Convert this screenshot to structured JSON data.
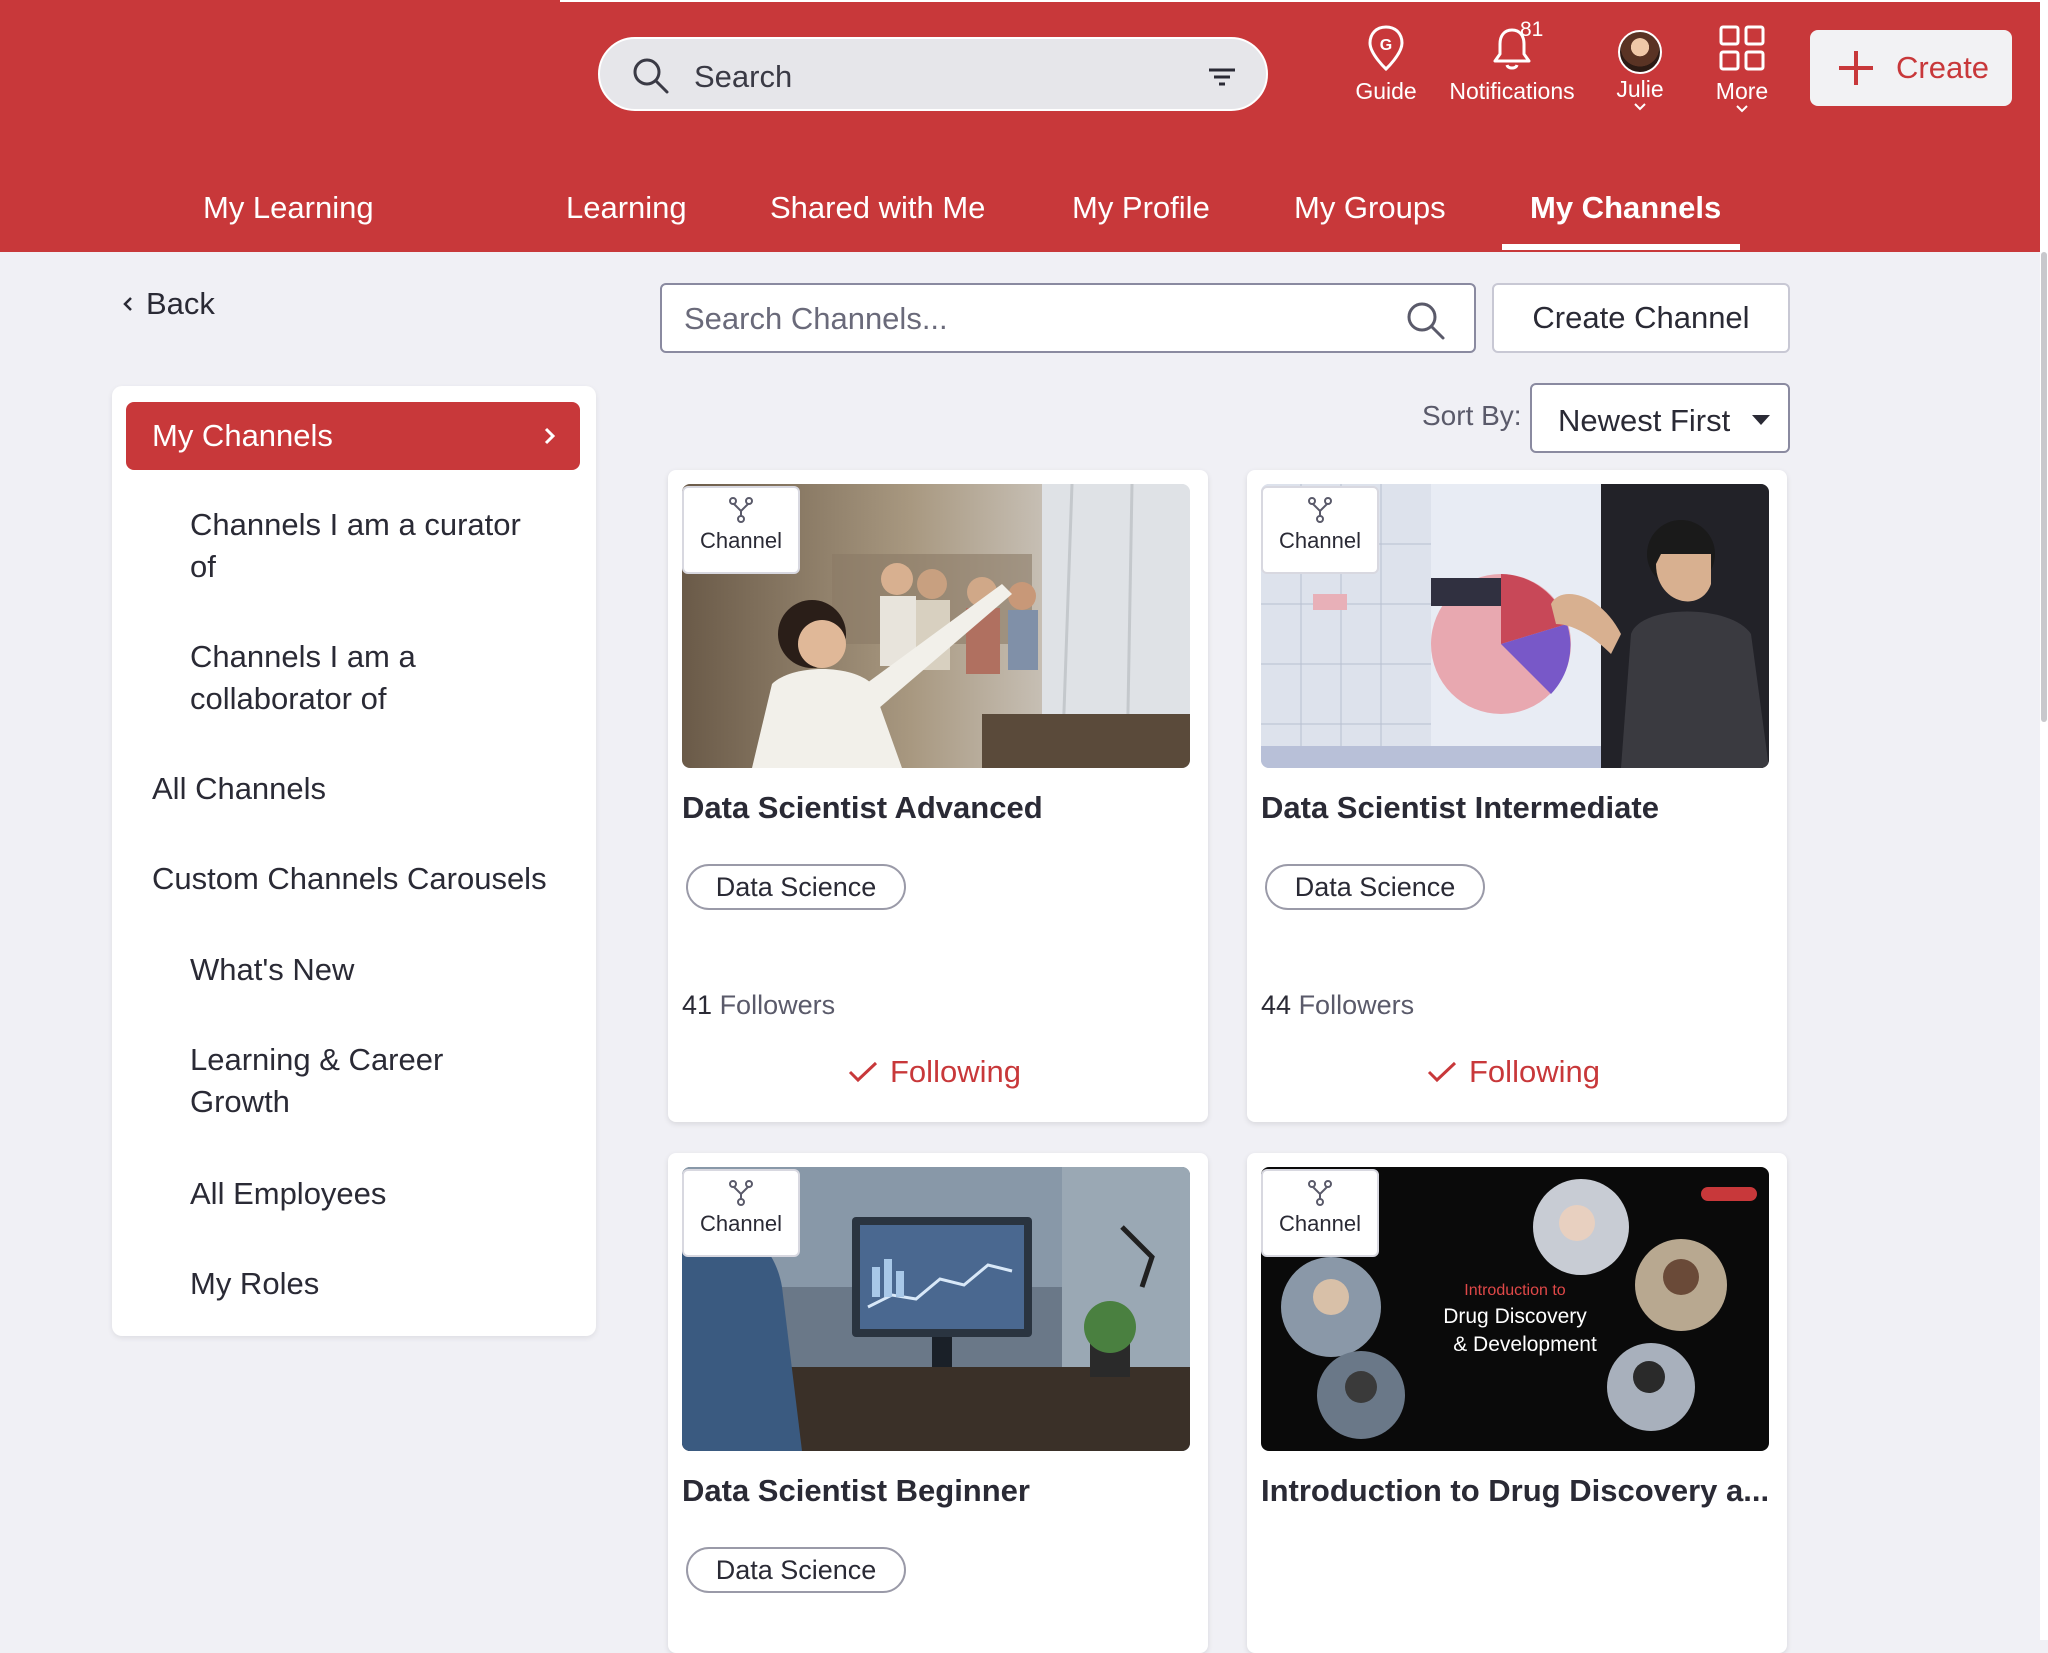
{
  "header": {
    "search_placeholder": "Search",
    "nav": {
      "guide": "Guide",
      "notifications": "Notifications",
      "notifications_count": "81",
      "user": "Julie",
      "more": "More"
    },
    "create_label": "Create"
  },
  "tabs": [
    {
      "label": "My Learning"
    },
    {
      "label": "Learning"
    },
    {
      "label": "Shared with Me"
    },
    {
      "label": "My Profile"
    },
    {
      "label": "My Groups"
    },
    {
      "label": "My Channels",
      "active": true
    }
  ],
  "sidebar": {
    "back_label": "Back",
    "active_item": "My Channels",
    "items": [
      {
        "label": "Channels I am a curator of"
      },
      {
        "label": "Channels I am a collaborator of"
      },
      {
        "label": "All Channels"
      },
      {
        "label": "Custom Channels Carousels"
      },
      {
        "label": "What's New"
      },
      {
        "label": "Learning & Career Growth"
      },
      {
        "label": "All Employees"
      },
      {
        "label": "My Roles"
      }
    ]
  },
  "content": {
    "search_placeholder": "Search Channels...",
    "create_channel_label": "Create Channel",
    "sort_label": "Sort By:",
    "sort_value": "Newest First"
  },
  "cards": [
    {
      "type_label": "Channel",
      "title": "Data Scientist Advanced",
      "tag": "Data Science",
      "followers_count": "41",
      "followers_label": "Followers",
      "follow_label": "Following"
    },
    {
      "type_label": "Channel",
      "title": "Data Scientist Intermediate",
      "tag": "Data Science",
      "followers_count": "44",
      "followers_label": "Followers",
      "follow_label": "Following"
    },
    {
      "type_label": "Channel",
      "title": "Data Scientist Beginner",
      "tag": "Data Science"
    },
    {
      "type_label": "Channel",
      "title": "Introduction to Drug Discovery a...",
      "thumb_text_1": "Introduction to",
      "thumb_text_2": "Drug Discovery",
      "thumb_text_3": "& Development"
    }
  ],
  "colors": {
    "brand_red": "#c8383a",
    "page_bg": "#f0f0f5",
    "card_bg": "#ffffff"
  },
  "icons": {
    "search": "search-icon",
    "filter": "filter-icon",
    "guide": "map-pin-icon",
    "notifications": "bell-icon",
    "more": "grid-icon",
    "create": "plus-icon",
    "channel": "channel-icon",
    "following": "check-icon"
  }
}
